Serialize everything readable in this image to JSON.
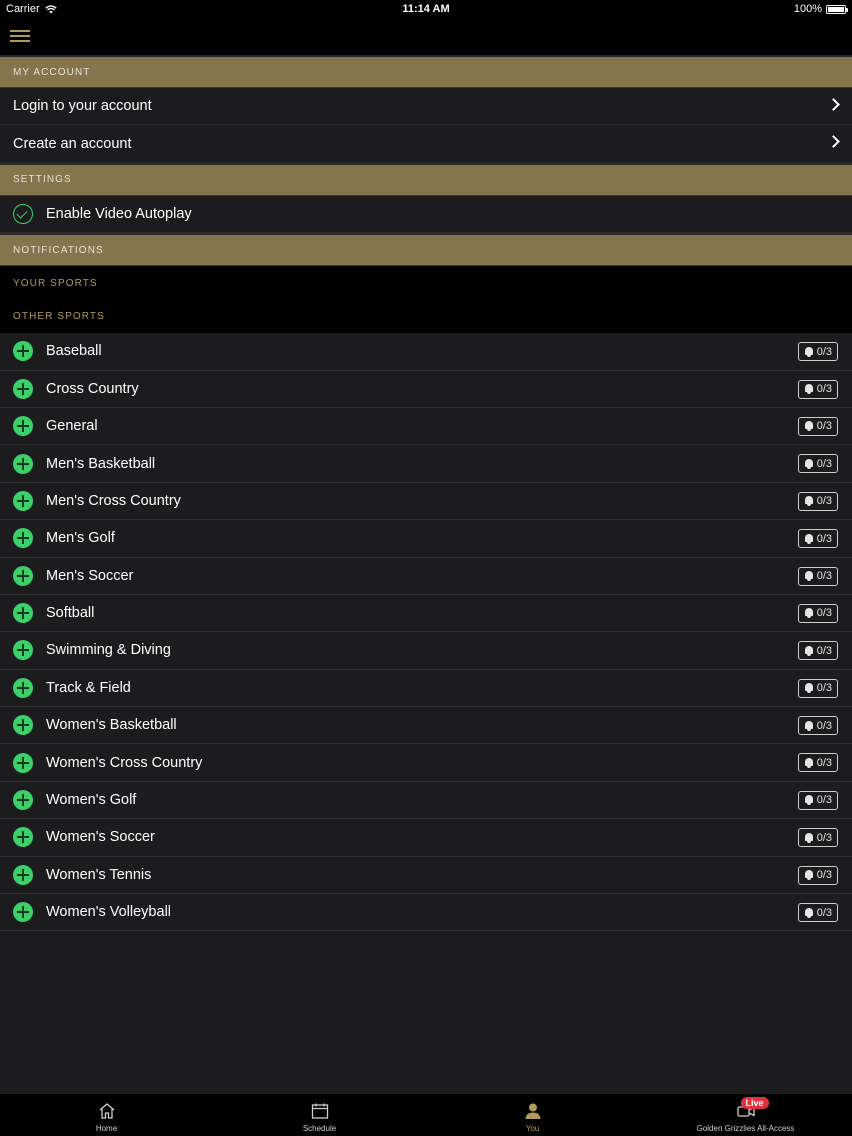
{
  "status": {
    "carrier": "Carrier",
    "time": "11:14 AM",
    "battery": "100%"
  },
  "nav": {
    "menu_icon": "hamburger-icon"
  },
  "account": {
    "header": "MY ACCOUNT",
    "items": [
      {
        "label": "Login to your account"
      },
      {
        "label": "Create an account"
      }
    ]
  },
  "settings": {
    "header": "SETTINGS",
    "autoplay_label": "Enable Video Autoplay",
    "autoplay_enabled": true
  },
  "notifications": {
    "header": "NOTIFICATIONS",
    "your_sports": "YOUR SPORTS",
    "other_sports": "OTHER SPORTS"
  },
  "sports": [
    {
      "name": "Baseball",
      "alerts": "0/3"
    },
    {
      "name": "Cross Country",
      "alerts": "0/3"
    },
    {
      "name": "General",
      "alerts": "0/3"
    },
    {
      "name": "Men's Basketball",
      "alerts": "0/3"
    },
    {
      "name": "Men's Cross Country",
      "alerts": "0/3"
    },
    {
      "name": "Men's Golf",
      "alerts": "0/3"
    },
    {
      "name": "Men's Soccer",
      "alerts": "0/3"
    },
    {
      "name": "Softball",
      "alerts": "0/3"
    },
    {
      "name": "Swimming & Diving",
      "alerts": "0/3"
    },
    {
      "name": "Track & Field",
      "alerts": "0/3"
    },
    {
      "name": "Women's Basketball",
      "alerts": "0/3"
    },
    {
      "name": "Women's Cross Country",
      "alerts": "0/3"
    },
    {
      "name": "Women's Golf",
      "alerts": "0/3"
    },
    {
      "name": "Women's Soccer",
      "alerts": "0/3"
    },
    {
      "name": "Women's Tennis",
      "alerts": "0/3"
    },
    {
      "name": "Women's Volleyball",
      "alerts": "0/3"
    }
  ],
  "tabs": [
    {
      "label": "Home",
      "icon": "home-icon",
      "active": false
    },
    {
      "label": "Schedule",
      "icon": "calendar-icon",
      "active": false
    },
    {
      "label": "You",
      "icon": "person-icon",
      "active": true
    },
    {
      "label": "Golden Grizzlies All-Access",
      "icon": "video-icon",
      "active": false,
      "badge": "Live"
    }
  ],
  "colors": {
    "gold": "#85754d",
    "gold_text": "#b09a5a",
    "green": "#3ad16a",
    "background": "#1c1c1e",
    "live_red": "#e0323c"
  }
}
